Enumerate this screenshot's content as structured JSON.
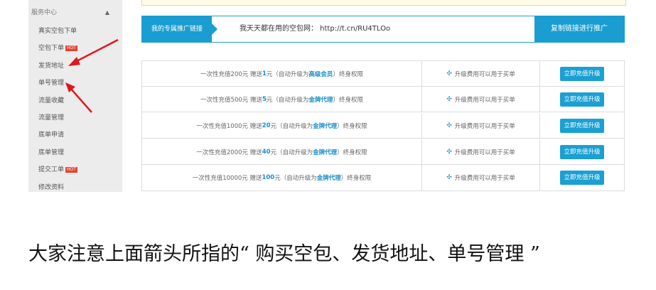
{
  "sidebar": {
    "header": "服务中心",
    "items": [
      {
        "label": "真实空包下单",
        "hot": ""
      },
      {
        "label": "空包下单",
        "hot": "HOT"
      },
      {
        "label": "发货地址",
        "hot": ""
      },
      {
        "label": "单号管理",
        "hot": ""
      },
      {
        "label": "流量收藏",
        "hot": ""
      },
      {
        "label": "流量管理",
        "hot": ""
      },
      {
        "label": "底单申请",
        "hot": ""
      },
      {
        "label": "底单管理",
        "hot": ""
      },
      {
        "label": "提交工单",
        "hot": "HOT"
      },
      {
        "label": "修改资料",
        "hot": ""
      }
    ]
  },
  "promo": {
    "label": "我的专属推广链接",
    "text": "我天天都在用的空包网： http://t.cn/RU4TLOo",
    "button": "复制链接进行推广"
  },
  "upgrades": [
    {
      "prefix": "一次性充值200元 赠送",
      "bonus": "1",
      "mid": "元（自动升级为 ",
      "level": "高级会员",
      "suffix": "）终身权限",
      "note": "升级费用可以用于买单",
      "button": "立即充值升级"
    },
    {
      "prefix": "一次性充值500元 赠送",
      "bonus": "5",
      "mid": "元（自动升级为 ",
      "level": "金牌代理",
      "suffix": "）终身权限",
      "note": "升级费用可以用于买单",
      "button": "立即充值升级"
    },
    {
      "prefix": "一次性充值1000元 赠送",
      "bonus": "20",
      "mid": "元（自动升级为 ",
      "level": "金牌代理",
      "suffix": "）终身权限",
      "note": "升级费用可以用于买单",
      "button": "立即充值升级"
    },
    {
      "prefix": "一次性充值2000元 赠送",
      "bonus": "40",
      "mid": "元（自动升级为 ",
      "level": "金牌代理",
      "suffix": "）终身权限",
      "note": "升级费用可以用于买单",
      "button": "立即充值升级"
    },
    {
      "prefix": "一次性充值10000元 赠送",
      "bonus": "100",
      "mid": "元（自动升级为 ",
      "level": "金牌代理",
      "suffix": "）终身权限",
      "note": "升级费用可以用于买单",
      "button": "立即充值升级"
    }
  ],
  "caption": "大家注意上面箭头所指的“ 购买空包、发货地址、单号管理 ”",
  "colors": {
    "accent": "#1a9dd1",
    "hot": "#e2432f",
    "arrow": "#e0161e"
  }
}
